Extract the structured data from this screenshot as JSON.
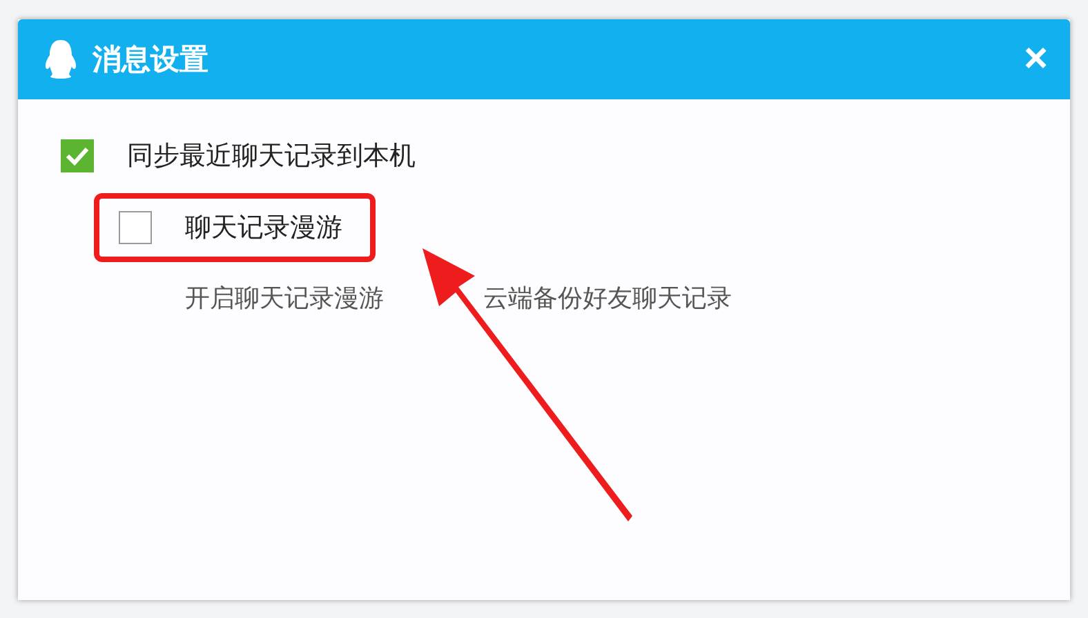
{
  "dialog": {
    "title": "消息设置",
    "close": "×"
  },
  "options": [
    {
      "label": "同步最近聊天记录到本机",
      "checked": true,
      "nested": false,
      "highlighted": false
    },
    {
      "label": "聊天记录漫游",
      "checked": false,
      "nested": true,
      "highlighted": true
    }
  ],
  "description": [
    "开启聊天记录漫游",
    "云端备份好友聊天记录"
  ]
}
